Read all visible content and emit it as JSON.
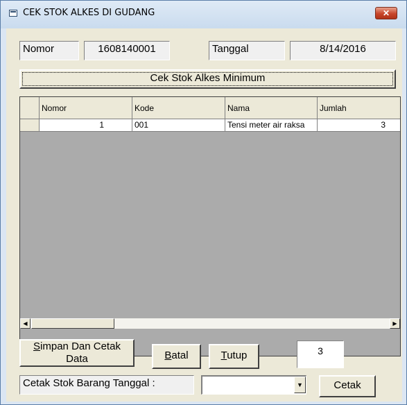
{
  "window": {
    "title": "CEK STOK ALKES DI GUDANG",
    "close_glyph": "✕"
  },
  "header": {
    "nomor_label": "Nomor",
    "nomor_value": "1608140001",
    "tanggal_label": "Tanggal",
    "tanggal_value": "8/14/2016"
  },
  "check_button": "Cek Stok Alkes Minimum",
  "grid": {
    "columns": [
      "Nomor",
      "Kode",
      "Nama",
      "Jumlah"
    ],
    "rows": [
      {
        "nomor": "1",
        "kode": "001",
        "nama": "Tensi meter air raksa",
        "jumlah": "3"
      }
    ]
  },
  "actions": {
    "simpan_first": "S",
    "simpan_rest": "impan Dan Cetak",
    "simpan_line2": "Data",
    "batal_first": "B",
    "batal_rest": "atal",
    "tutup_first": "T",
    "tutup_rest": "utup",
    "count_value": "3"
  },
  "footer": {
    "label": "Cetak Stok Barang Tanggal :",
    "combo_value": "",
    "cetak_button": "Cetak"
  }
}
